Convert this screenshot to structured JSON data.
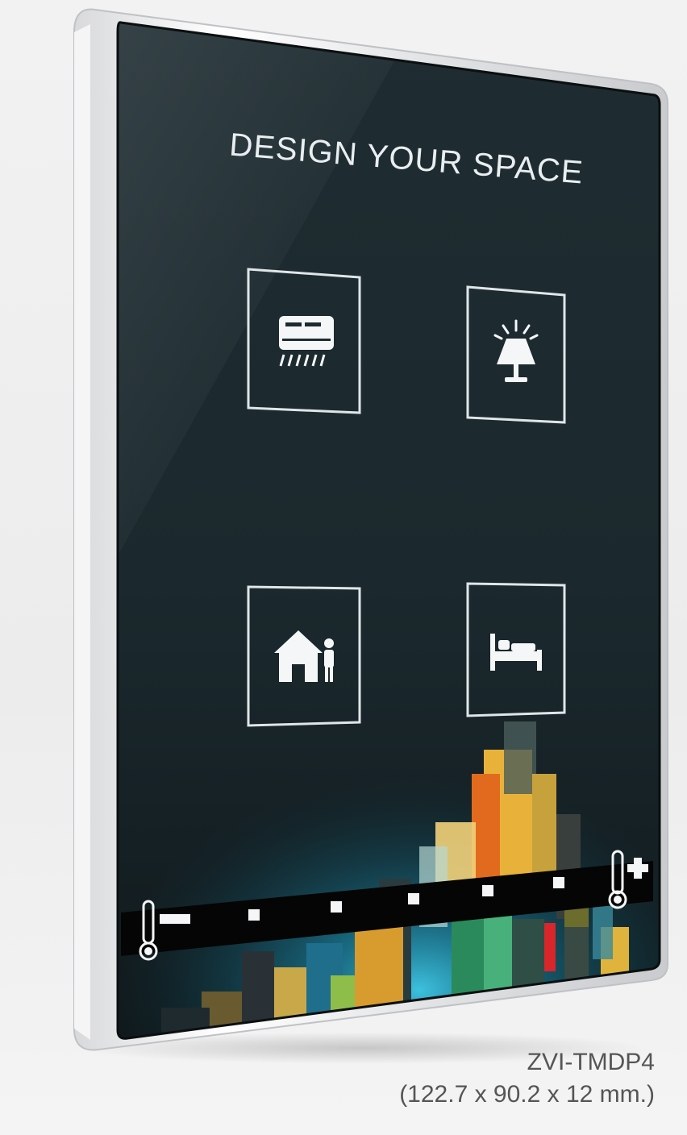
{
  "panel": {
    "headline": "DESIGN YOUR SPACE",
    "frame_color": "#e9eaec",
    "glass_color": "#1d2b30",
    "icon_stroke_color": "#dfe6e8"
  },
  "buttons": [
    {
      "id": "air-conditioner",
      "icon": "air-conditioner-icon"
    },
    {
      "id": "table-lamp",
      "icon": "table-lamp-icon"
    },
    {
      "id": "home-presence",
      "icon": "home-person-icon"
    },
    {
      "id": "bedroom",
      "icon": "bed-icon"
    }
  ],
  "slider": {
    "minus_icon": "thermometer-minus-icon",
    "plus_icon": "thermometer-plus-icon",
    "steps": 5
  },
  "caption": {
    "model": "ZVI-TMDP4",
    "dimensions": "(122.7 x 90.2 x 12 mm.)"
  }
}
